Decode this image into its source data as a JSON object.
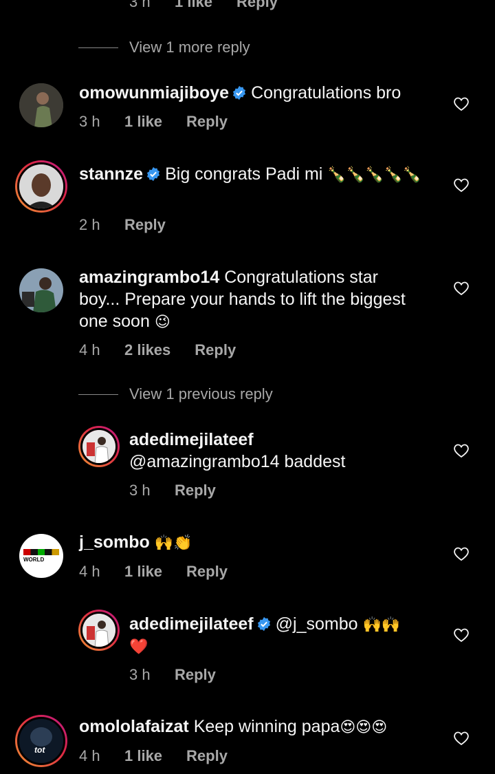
{
  "top_meta": {
    "time": "3 h",
    "likes": "1 like",
    "reply": "Reply"
  },
  "view_more_1": "View 1 more reply",
  "comments": [
    {
      "user": "omowunmiajiboye",
      "verified": true,
      "text": "Congratulations bro",
      "time": "3 h",
      "likes": "1 like",
      "reply": "Reply"
    },
    {
      "user": "stannze",
      "verified": true,
      "text": "Big congrats Padi mi",
      "emoji": "🍾🍾🍾🍾🍾",
      "time": "2 h",
      "reply": "Reply"
    },
    {
      "user": "amazingrambo14",
      "verified": false,
      "text_line1": "Congratulations star",
      "text_line2": "boy... Prepare your hands to lift the biggest",
      "text_line3": "one soon",
      "emoji": "😉",
      "time": "4 h",
      "likes": "2 likes",
      "reply": "Reply"
    },
    {
      "user": "j_sombo",
      "verified": false,
      "emoji": "🙌👏",
      "avatar_text": "WORLD",
      "time": "4 h",
      "likes": "1 like",
      "reply": "Reply"
    },
    {
      "user": "omololafaizat",
      "verified": false,
      "text": "Keep winning papa",
      "emoji": "😍😍😍",
      "avatar_text": "tot",
      "time": "4 h",
      "likes": "1 like",
      "reply": "Reply"
    }
  ],
  "view_previous": "View 1 previous reply",
  "replies": [
    {
      "user": "adedimejilateef",
      "verified": false,
      "text": "@amazingrambo14 baddest",
      "time": "3 h",
      "reply": "Reply"
    },
    {
      "user": "adedimejilateef",
      "verified": true,
      "text": "@j_sombo",
      "emoji": "🙌🙌",
      "emoji2": "❤️",
      "time": "3 h",
      "reply": "Reply"
    }
  ],
  "colors": {
    "background": "#000000",
    "text": "#f5f5f5",
    "muted": "#a8a8a8",
    "verified": "#3897f0",
    "story_ring": "#dc2743"
  },
  "icons": [
    "heart-outline-icon",
    "verified-badge-icon"
  ]
}
